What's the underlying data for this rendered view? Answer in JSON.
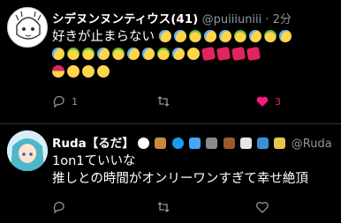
{
  "tweets": [
    {
      "name": "シデヌンヌンティウス(41)",
      "handle": "@puiiiuniii · 2分",
      "text_lines": [
        "好きが止まらない",
        "",
        ""
      ],
      "emoji_rows": [
        [
          "cry",
          "cry",
          "sick",
          "cry",
          "cry",
          "sick",
          "cry",
          "sick",
          "cry"
        ],
        [
          "cry",
          "sick",
          "sick",
          "cry",
          "sick",
          "cry",
          "cry",
          "sick",
          "cry",
          "smile",
          "heart",
          "heart",
          "heart",
          "heart"
        ],
        [
          "santa",
          "smile",
          "smile",
          "smile"
        ]
      ],
      "reply_count": "1",
      "retweet_count": "",
      "like_count": "3"
    },
    {
      "name": "Ruda【るだ】",
      "handle": "@Ruda",
      "text_lines": [
        "1on1ていいな",
        "推しとの時間がオンリーワンすぎて幸せ絶頂"
      ],
      "reply_count": "",
      "retweet_count": "",
      "like_count": ""
    }
  ],
  "colors": {
    "like_accent": "#f91880",
    "muted": "#8b98a5",
    "divider": "#2f3336"
  }
}
